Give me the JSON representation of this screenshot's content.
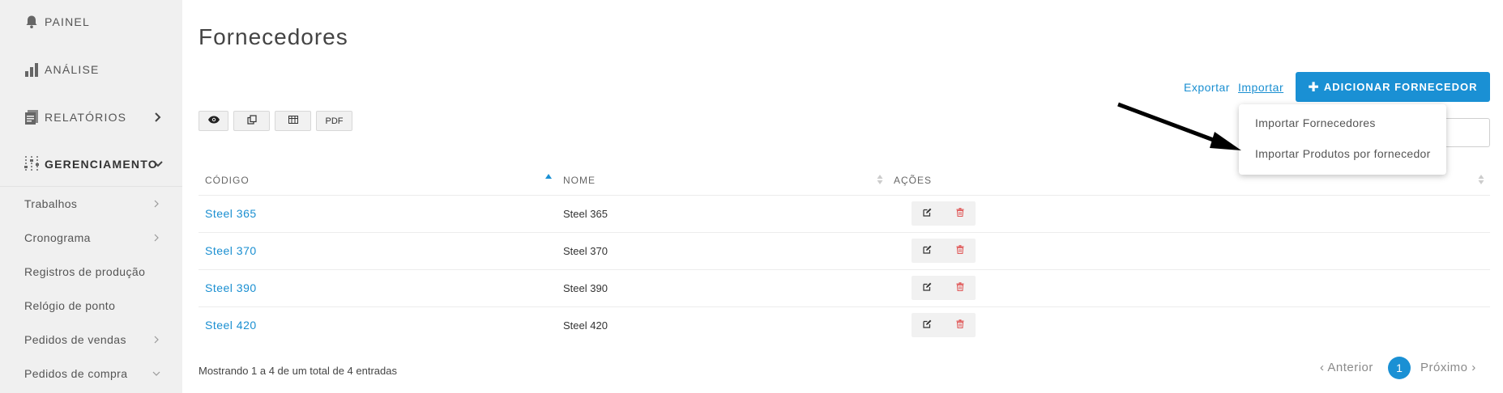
{
  "sidebar": {
    "main_items": [
      {
        "label": "PAINEL",
        "icon": "bell-icon"
      },
      {
        "label": "ANÁLISE",
        "icon": "bar-chart-icon"
      },
      {
        "label": "RELATÓRIOS",
        "icon": "report-icon"
      },
      {
        "label": "GERENCIAMENTO",
        "icon": "sliders-icon"
      }
    ],
    "sub_items": [
      {
        "label": "Trabalhos",
        "has_chevron": true
      },
      {
        "label": "Cronograma",
        "has_chevron": true
      },
      {
        "label": "Registros de produção",
        "has_chevron": false
      },
      {
        "label": "Relógio de ponto",
        "has_chevron": false
      },
      {
        "label": "Pedidos de vendas",
        "has_chevron": true
      },
      {
        "label": "Pedidos de compra",
        "has_chevron": true
      }
    ]
  },
  "page": {
    "title": "Fornecedores"
  },
  "actions": {
    "export_label": "Exportar",
    "import_label": "Importar",
    "add_label": "ADICIONAR FORNECEDOR"
  },
  "toolbar": {
    "pdf_label": "PDF"
  },
  "import_menu": {
    "items": [
      "Importar Fornecedores",
      "Importar Produtos por fornecedor"
    ]
  },
  "table": {
    "columns": [
      "CÓDIGO",
      "NOME",
      "AÇÕES"
    ],
    "rows": [
      {
        "code": "Steel 365",
        "name": "Steel 365"
      },
      {
        "code": "Steel 370",
        "name": "Steel 370"
      },
      {
        "code": "Steel 390",
        "name": "Steel 390"
      },
      {
        "code": "Steel 420",
        "name": "Steel 420"
      }
    ]
  },
  "footer": {
    "info": "Mostrando 1 a 4 de um total de 4 entradas",
    "prev_label": "Anterior",
    "current_page": "1",
    "next_label": "Próximo"
  },
  "colors": {
    "accent": "#1a90d4",
    "link": "#1a8fd1",
    "sidebar_bg": "#f0f0f0",
    "delete_icon": "#e05a5a"
  }
}
